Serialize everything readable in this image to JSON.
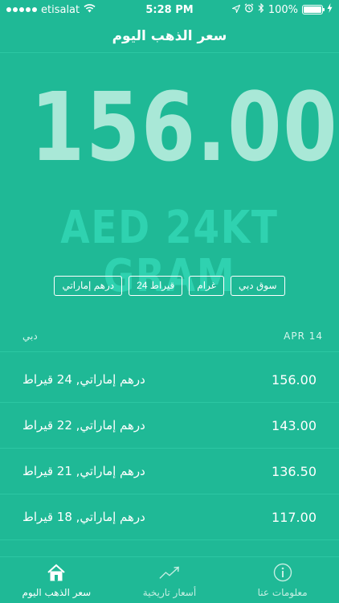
{
  "status_bar": {
    "carrier": "etisalat",
    "time": "5:28 PM",
    "battery_percent": "100%",
    "icons": [
      "signal-icon",
      "wifi-icon",
      "location-icon",
      "alarm-icon",
      "bluetooth-icon",
      "battery-icon",
      "charging-icon"
    ]
  },
  "nav": {
    "title": "سعر الذهب اليوم"
  },
  "hero": {
    "price": "156.00",
    "unit": "AED 24KT GRAM"
  },
  "filters": [
    {
      "label": "درهم إماراتي"
    },
    {
      "label": "قيراط 24"
    },
    {
      "label": "غرام"
    },
    {
      "label": "سوق دبي"
    }
  ],
  "list": {
    "date": "APR 14",
    "region": "دبي",
    "rows": [
      {
        "price": "156.00",
        "label": "درهم إماراتي, 24 قيراط"
      },
      {
        "price": "143.00",
        "label": "درهم إماراتي, 22 قيراط"
      },
      {
        "price": "136.50",
        "label": "درهم إماراتي, 21 قيراط"
      },
      {
        "price": "117.00",
        "label": "درهم إماراتي, 18 قيراط"
      }
    ]
  },
  "tabs": [
    {
      "label": "سعر الذهب اليوم",
      "icon": "home-icon"
    },
    {
      "label": "أسعار تاريخية",
      "icon": "trend-chart-icon"
    },
    {
      "label": "معلومات عنا",
      "icon": "info-icon"
    }
  ],
  "colors": {
    "background": "#1fb996",
    "hero_price": "#a9e8d7",
    "hero_unit": "#2fd2b0",
    "divider": "#2cc7a3"
  }
}
